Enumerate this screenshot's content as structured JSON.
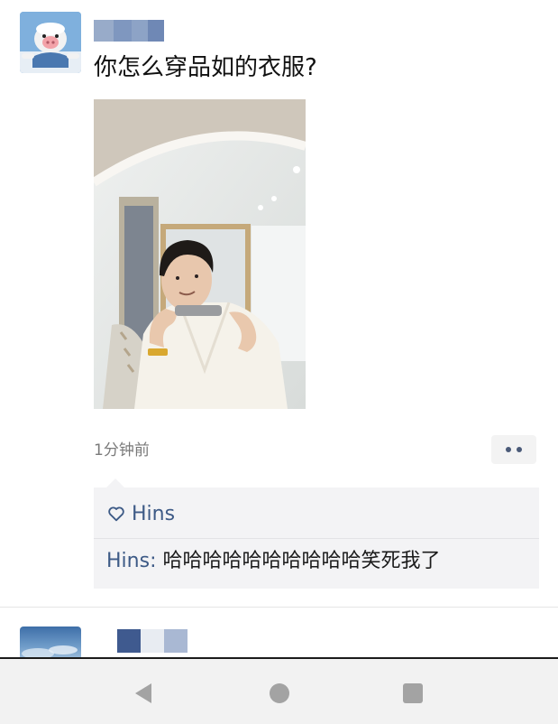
{
  "post": {
    "text": "你怎么穿品如的衣服?",
    "timestamp": "1分钟前",
    "likes": {
      "names": "Hins"
    },
    "comments": [
      {
        "author": "Hins",
        "separator": ": ",
        "text": "哈哈哈哈哈哈哈哈哈哈笑死我了"
      }
    ]
  },
  "icons": {
    "more": "more-options-icon",
    "like": "heart-outline-icon",
    "nav_back": "triangle-back-icon",
    "nav_home": "circle-home-icon",
    "nav_recent": "square-recents-icon"
  },
  "colors": {
    "link_blue": "#3d5a86",
    "interact_bg": "#f3f3f5",
    "nav_bg": "#f2f2f2",
    "timestamp_gray": "#7a7a7a"
  }
}
